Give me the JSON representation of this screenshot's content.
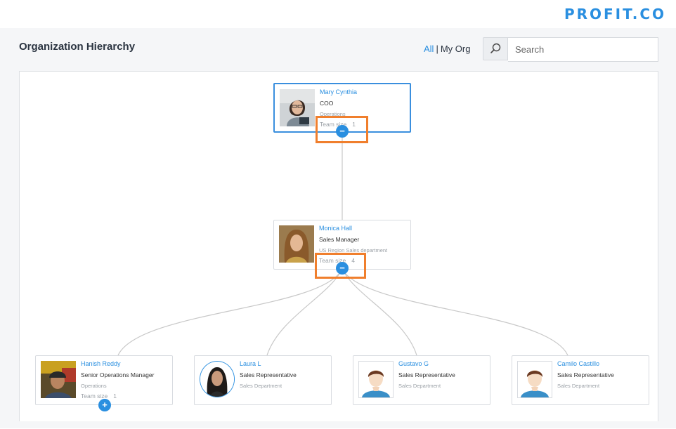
{
  "header": {
    "logo_text": "PROFIT.CO",
    "brand_color": "#2a8fe0"
  },
  "page": {
    "title": "Organization Hierarchy"
  },
  "scope": {
    "all_label": "All",
    "separator": "|",
    "myorg_label": "My Org"
  },
  "search": {
    "placeholder": "Search",
    "icon": "search-icon"
  },
  "colors": {
    "accent": "#2a8fe0",
    "highlight": "#f07f2d",
    "connector": "#c8c8c8"
  },
  "org": {
    "root": {
      "name": "Mary Cynthia",
      "role": "COO",
      "department": "Operations",
      "team_label": "Team size",
      "team_size": "1",
      "toggle": "−"
    },
    "manager": {
      "name": "Monica Hall",
      "role": "Sales Manager",
      "department": "US Region Sales department",
      "team_label": "Team size",
      "team_size": "4",
      "toggle": "−"
    },
    "reports": [
      {
        "name": "Hanish Reddy",
        "role": "Senior Operations Manager",
        "department": "Operations",
        "team_label": "Team size",
        "team_size": "1",
        "toggle": "+"
      },
      {
        "name": "Laura L",
        "role": "Sales Representative",
        "department": "Sales Department"
      },
      {
        "name": "Gustavo G",
        "role": "Sales Representative",
        "department": "Sales Department"
      },
      {
        "name": "Camilo Castillo",
        "role": "Sales Representative",
        "department": "Sales Department"
      }
    ]
  }
}
